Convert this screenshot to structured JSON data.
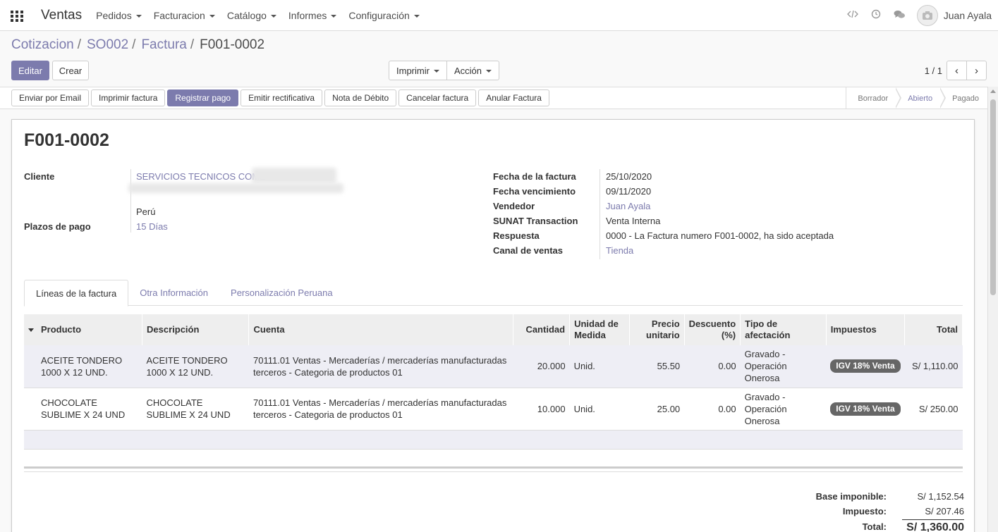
{
  "navbar": {
    "app_name": "Ventas",
    "menu": [
      "Pedidos",
      "Facturacion",
      "Catálogo",
      "Informes",
      "Configuración"
    ],
    "user": "Juan Ayala"
  },
  "breadcrumb": {
    "items": [
      "Cotizacion",
      "SO002",
      "Factura"
    ],
    "current": "F001-0002"
  },
  "buttons": {
    "edit": "Editar",
    "create": "Crear",
    "print": "Imprimir",
    "action": "Acción"
  },
  "pager": {
    "text": "1 / 1",
    "prev": "‹",
    "next": "›"
  },
  "statusbar": {
    "buttons": [
      "Enviar por Email",
      "Imprimir factura",
      "Registrar pago",
      "Emitir rectificativa",
      "Nota de Débito",
      "Cancelar factura",
      "Anular Factura"
    ],
    "states": [
      "Borrador",
      "Abierto",
      "Pagado"
    ],
    "active_state": "Abierto"
  },
  "invoice": {
    "number": "F001-0002",
    "cliente_label": "Cliente",
    "cliente": "SERVICIOS TECNICOS COME",
    "country": "Perú",
    "plazos_label": "Plazos de pago",
    "plazos": "15 Días",
    "right_fields": [
      {
        "label": "Fecha de la factura",
        "value": "25/10/2020"
      },
      {
        "label": "Fecha vencimiento",
        "value": "09/11/2020"
      },
      {
        "label": "Vendedor",
        "value": "Juan Ayala"
      },
      {
        "label": "SUNAT Transaction",
        "value": "Venta Interna"
      },
      {
        "label": "Respuesta",
        "value": "0000 - La Factura numero F001-0002, ha sido aceptada"
      },
      {
        "label": "Canal de ventas",
        "value": "Tienda"
      }
    ]
  },
  "tabs": [
    "Líneas de la factura",
    "Otra Información",
    "Personalización Peruana"
  ],
  "table": {
    "headers": {
      "producto": "Producto",
      "descripcion": "Descripción",
      "cuenta": "Cuenta",
      "cantidad": "Cantidad",
      "unidad": "Unidad de Medida",
      "precio": "Precio unitario",
      "descuento": "Descuento (%)",
      "tipo": "Tipo de afectación",
      "impuestos": "Impuestos",
      "total": "Total"
    },
    "rows": [
      {
        "producto": "ACEITE TONDERO 1000 X 12 UND.",
        "descripcion": "ACEITE TONDERO 1000 X 12 UND.",
        "cuenta": "70111.01 Ventas - Mercaderías / mercaderías manufacturadas terceros - Categoria de productos 01",
        "cantidad": "20.000",
        "unidad": "Unid.",
        "precio": "55.50",
        "descuento": "0.00",
        "tipo": "Gravado - Operación Onerosa",
        "impuestos": "IGV 18% Venta",
        "total": "S/ 1,110.00"
      },
      {
        "producto": "CHOCOLATE SUBLIME X 24 UND",
        "descripcion": "CHOCOLATE SUBLIME X 24 UND",
        "cuenta": "70111.01 Ventas - Mercaderías / mercaderías manufacturadas terceros - Categoria de productos 01",
        "cantidad": "10.000",
        "unidad": "Unid.",
        "precio": "25.00",
        "descuento": "0.00",
        "tipo": "Gravado - Operación Onerosa",
        "impuestos": "IGV 18% Venta",
        "total": "S/ 250.00"
      }
    ]
  },
  "totals": {
    "base_label": "Base imponible:",
    "base": "S/ 1,152.54",
    "tax_label": "Impuesto:",
    "tax": "S/ 207.46",
    "total_label": "Total:",
    "total": "S/ 1,360.00"
  },
  "colors": {
    "accent": "#7c7bad",
    "badge": "#666666"
  }
}
